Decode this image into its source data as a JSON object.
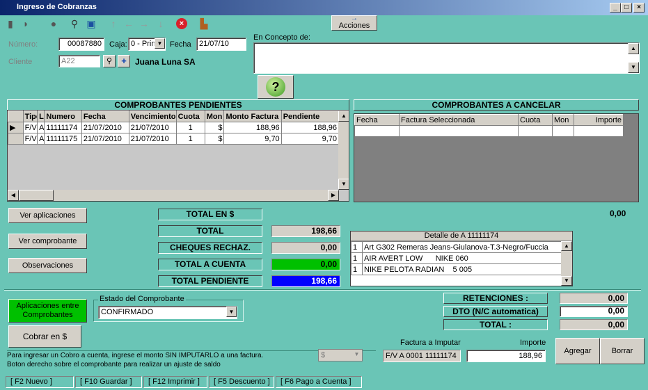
{
  "window": {
    "title": "Ingreso de Cobranzas"
  },
  "toolbar": {
    "acciones_label": "Acciones"
  },
  "header": {
    "numero_label": "Número:",
    "numero_value": "00087880",
    "caja_label": "Caja:",
    "caja_value": "0 - Prin",
    "fecha_label": "Fecha",
    "fecha_value": "21/07/10",
    "cliente_label": "Cliente",
    "cliente_code": "A22",
    "cliente_name": "Juana Luna SA",
    "concepto_label": "En Concepto de:"
  },
  "pendientes": {
    "title": "COMPROBANTES PENDIENTES",
    "columns": [
      "Tipo",
      "L",
      "Numero",
      "Fecha",
      "Vencimiento",
      "Cuota",
      "Mon",
      "Monto Factura",
      "Pendiente"
    ],
    "rows": [
      [
        "F/V",
        "A",
        "11111174",
        "21/07/2010",
        "21/07/2010",
        "1",
        "$",
        "188,96",
        "188,96"
      ],
      [
        "F/V",
        "A",
        "11111175",
        "21/07/2010",
        "21/07/2010",
        "1",
        "$",
        "9,70",
        "9,70"
      ]
    ]
  },
  "cancelar": {
    "title": "COMPROBANTES A CANCELAR",
    "columns": [
      "Fecha",
      "Factura Seleccionada",
      "Cuota",
      "Mon",
      "Importe"
    ],
    "total_value": "0,00"
  },
  "buttons": {
    "ver_aplicaciones": "Ver aplicaciones",
    "ver_comprobante": "Ver comprobante",
    "observaciones": "Observaciones",
    "aplicaciones_entre": "Aplicaciones entre Comprobantes",
    "cobrar": "Cobrar en $",
    "agregar": "Agregar",
    "borrar": "Borrar"
  },
  "totals": {
    "total_en": "TOTAL EN $",
    "total_label": "TOTAL",
    "total_value": "198,66",
    "cheques_label": "CHEQUES RECHAZ.",
    "cheques_value": "0,00",
    "acuenta_label": "TOTAL A CUENTA",
    "acuenta_value": "0,00",
    "pendiente_label": "TOTAL PENDIENTE",
    "pendiente_value": "198,66"
  },
  "detalle": {
    "title": "Detalle de A 11111174",
    "rows": [
      [
        "1",
        "Art G302 Remeras Jeans-Giulanova-T.3-Negro/Fuccia"
      ],
      [
        "1",
        "AIR AVERT LOW      NIKE 060"
      ],
      [
        "1",
        "NIKE PELOTA RADIAN    5 005"
      ]
    ]
  },
  "estado": {
    "label": "Estado del Comprobante",
    "value": "CONFIRMADO"
  },
  "retenciones": {
    "ret_label": "RETENCIONES :",
    "ret_value": "0,00",
    "dto_label": "DTO (N/C automatica)",
    "dto_value": "0,00",
    "total_label": "TOTAL :",
    "total_value": "0,00"
  },
  "info": {
    "line1": "Para ingresar un Cobro a cuenta, ingrese el monto SIN IMPUTARLO a una factura.",
    "line2": "Boton derecho sobre el comprobante para realizar un ajuste de saldo",
    "moneda": "$"
  },
  "imputar": {
    "factura_label": "Factura a Imputar",
    "factura_value": "F/V A 0001 11111174",
    "importe_label": "Importe",
    "importe_value": "188,96"
  },
  "statusbar": [
    "[ F2 Nuevo ]",
    "[ F10 Guardar ]",
    "[ F12 Imprimir ]",
    "[ F5 Descuento ]",
    "[ F6 Pago a Cuenta ]"
  ],
  "colors": {
    "background": "#6ac5b6",
    "acuenta": "#00c000",
    "pendiente": "#0000ff",
    "aplic_btn": "#00c000"
  }
}
